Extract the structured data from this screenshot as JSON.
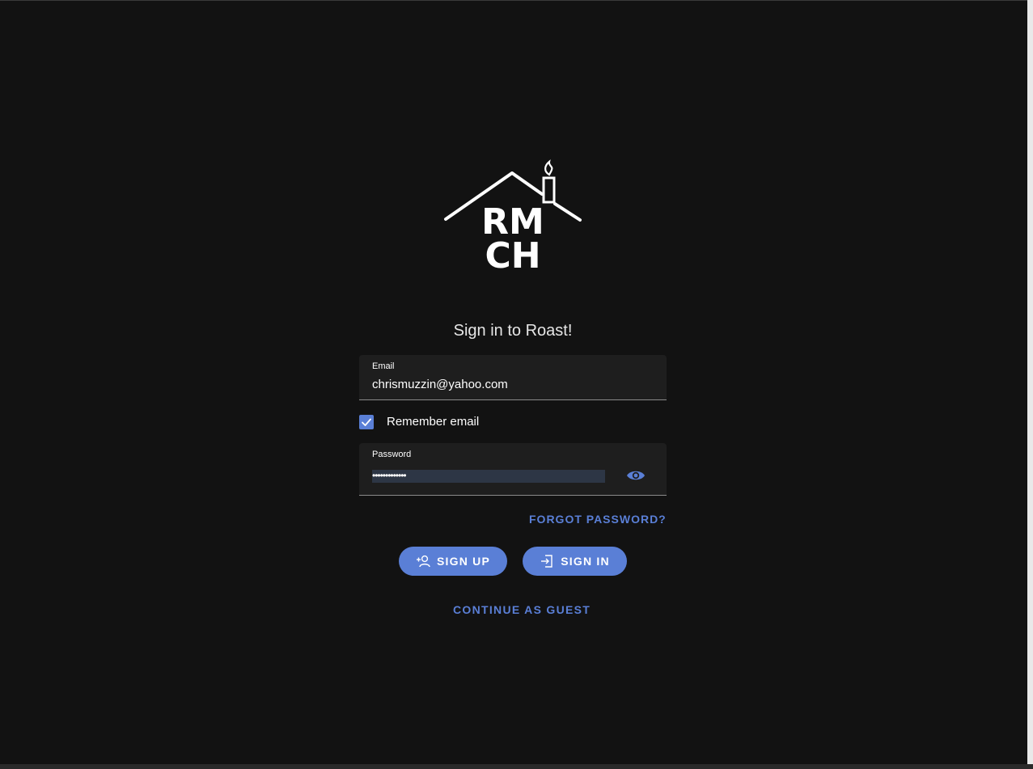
{
  "logo": {
    "line1": "RM",
    "line2": "CH"
  },
  "signin": {
    "title": "Sign in to Roast!",
    "email": {
      "label": "Email",
      "value": "chrismuzzin@yahoo.com"
    },
    "remember": {
      "label": "Remember email",
      "checked": true
    },
    "password": {
      "label": "Password",
      "masked_value": "•••••••••••••"
    },
    "forgot_label": "FORGOT PASSWORD?",
    "signup_label": "SIGN UP",
    "signin_label": "SIGN IN",
    "guest_label": "CONTINUE AS GUEST"
  },
  "colors": {
    "background": "#121212",
    "field": "#1e1e1e",
    "accent": "#5a7fd6"
  },
  "icons": {
    "eye": "eye-icon",
    "signup": "person-add-icon",
    "signin": "login-icon",
    "check": "check-icon"
  }
}
